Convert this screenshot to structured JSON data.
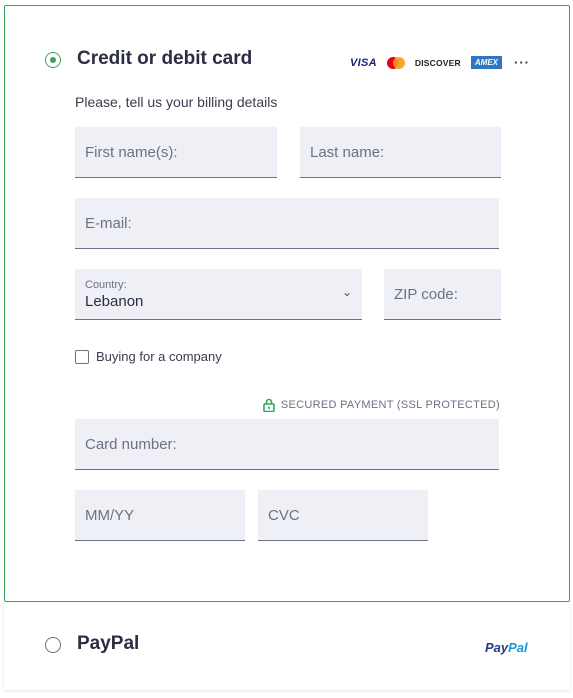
{
  "card_method": {
    "title": "Credit or debit card",
    "selected": true,
    "brands": {
      "visa": "VISA",
      "discover": "DISCOVER",
      "amex": "AMEX",
      "more": "···"
    },
    "subtitle": "Please, tell us your billing details",
    "fields": {
      "first_name": "First name(s):",
      "last_name": "Last name:",
      "email": "E-mail:",
      "country_label": "Country:",
      "country_value": "Lebanon",
      "zip": "ZIP code:",
      "card_number": "Card number:",
      "expiry": "MM/YY",
      "cvc": "CVC"
    },
    "company_checkbox": {
      "label": "Buying for a company",
      "checked": false
    },
    "secure_text": "SECURED PAYMENT (SSL PROTECTED)"
  },
  "paypal_method": {
    "title": "PayPal",
    "selected": false,
    "logo_pay": "Pay",
    "logo_pal": "Pal"
  },
  "colors": {
    "accent": "#3aa35a",
    "field_bg": "#efeff6",
    "text_dark": "#2b2d42",
    "text_muted": "#6e7083"
  }
}
